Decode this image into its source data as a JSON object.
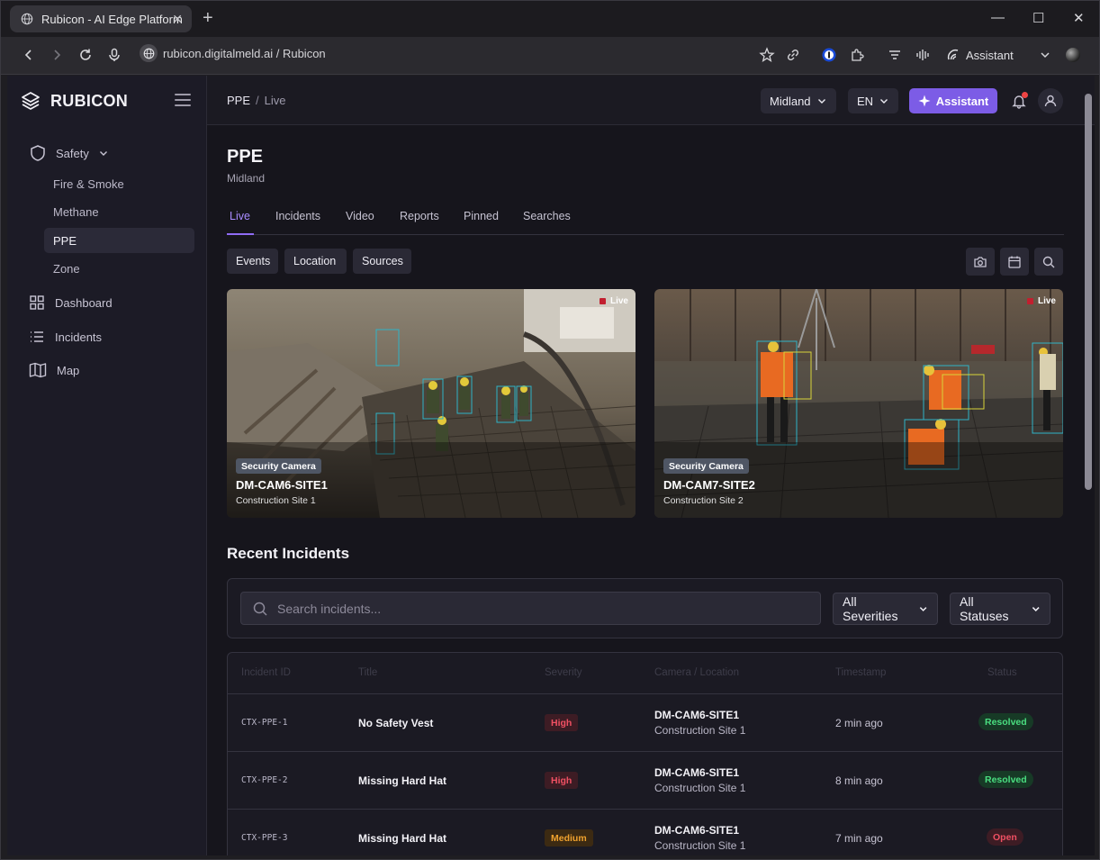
{
  "browser": {
    "tab_title": "Rubicon - AI Edge Platform",
    "url": "rubicon.digitalmeld.ai / Rubicon",
    "assistant_label": "Assistant"
  },
  "sidebar": {
    "brand": "RUBICON",
    "group_label": "Safety",
    "sub_items": [
      "Fire & Smoke",
      "Methane",
      "PPE",
      "Zone"
    ],
    "active_sub_item": "PPE",
    "main_items": [
      "Dashboard",
      "Incidents",
      "Map"
    ]
  },
  "topbar": {
    "breadcrumb_root": "PPE",
    "breadcrumb_sep": "/",
    "breadcrumb_current": "Live",
    "site_select": "Midland",
    "lang_select": "EN",
    "assistant_button": "Assistant"
  },
  "page": {
    "title": "PPE",
    "subtitle": "Midland",
    "tabs": [
      "Live",
      "Incidents",
      "Video",
      "Reports",
      "Pinned",
      "Searches"
    ],
    "active_tab": "Live",
    "filters": [
      "Events",
      "Location",
      "Sources"
    ]
  },
  "cameras": [
    {
      "badge": "Security Camera",
      "name": "DM-CAM6-SITE1",
      "site": "Construction Site 1",
      "live": "Live"
    },
    {
      "badge": "Security Camera",
      "name": "DM-CAM7-SITE2",
      "site": "Construction Site 2",
      "live": "Live"
    }
  ],
  "incidents": {
    "section_title": "Recent Incidents",
    "search_placeholder": "Search incidents...",
    "severity_filter": "All Severities",
    "status_filter": "All Statuses",
    "columns": [
      "Incident ID",
      "Title",
      "Severity",
      "Camera / Location",
      "Timestamp",
      "Status"
    ],
    "rows": [
      {
        "id": "CTX-PPE-1",
        "title": "No Safety Vest",
        "severity": "High",
        "camera": "DM-CAM6-SITE1",
        "location": "Construction Site 1",
        "timestamp": "2 min ago",
        "status": "Resolved"
      },
      {
        "id": "CTX-PPE-2",
        "title": "Missing Hard Hat",
        "severity": "High",
        "camera": "DM-CAM6-SITE1",
        "location": "Construction Site 1",
        "timestamp": "8 min ago",
        "status": "Resolved"
      },
      {
        "id": "CTX-PPE-3",
        "title": "Missing Hard Hat",
        "severity": "Medium",
        "camera": "DM-CAM6-SITE1",
        "location": "Construction Site 1",
        "timestamp": "7 min ago",
        "status": "Open"
      }
    ]
  },
  "colors": {
    "accent": "#7c5ce6",
    "sidebar_bg": "#1c1b26",
    "page_bg": "#16151c",
    "high": "#f05063",
    "medium": "#f0a22e",
    "resolved": "#4ade80"
  }
}
